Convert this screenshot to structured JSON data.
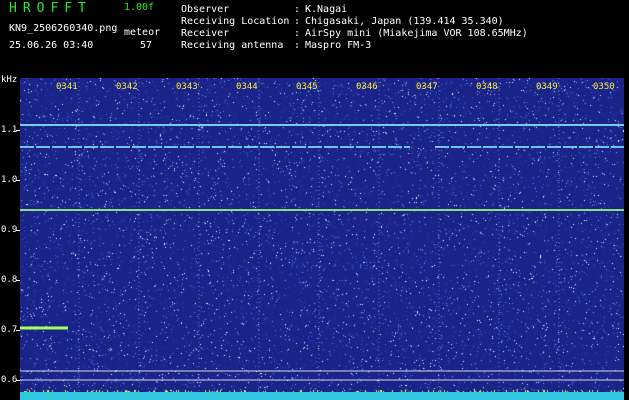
{
  "app": {
    "title": "HROFFT",
    "version": "1.00f",
    "file_name": "KN9_2506260340.png",
    "datetime": "25.06.26 03:40",
    "meteor_label": "meteor",
    "meteor_count": "57"
  },
  "info": [
    {
      "label": "Observer",
      "value": "K.Nagai"
    },
    {
      "label": "Receiving Location",
      "value": "Chigasaki, Japan (139.414 35.340)"
    },
    {
      "label": "Receiver",
      "value": "AirSpy mini (Miakejima VOR 108.65MHz)"
    },
    {
      "label": "Receiving antenna",
      "value": "Maspro FM-3"
    }
  ],
  "spectrogram": {
    "y_unit": "kHz",
    "y_ticks": [
      "1.1",
      "1.0",
      "0.9",
      "0.8",
      "0.7",
      "0.6"
    ],
    "x_ticks": [
      "0341",
      "0342",
      "0343",
      "0344",
      "0345",
      "0346",
      "0347",
      "0348",
      "0349",
      "0350"
    ]
  },
  "colors": {
    "header_text": "#28e828",
    "info_text": "#ffffff",
    "time_labels": "#ffee33",
    "background": "#1a2488",
    "bottom_bar": "#30c8e0"
  }
}
